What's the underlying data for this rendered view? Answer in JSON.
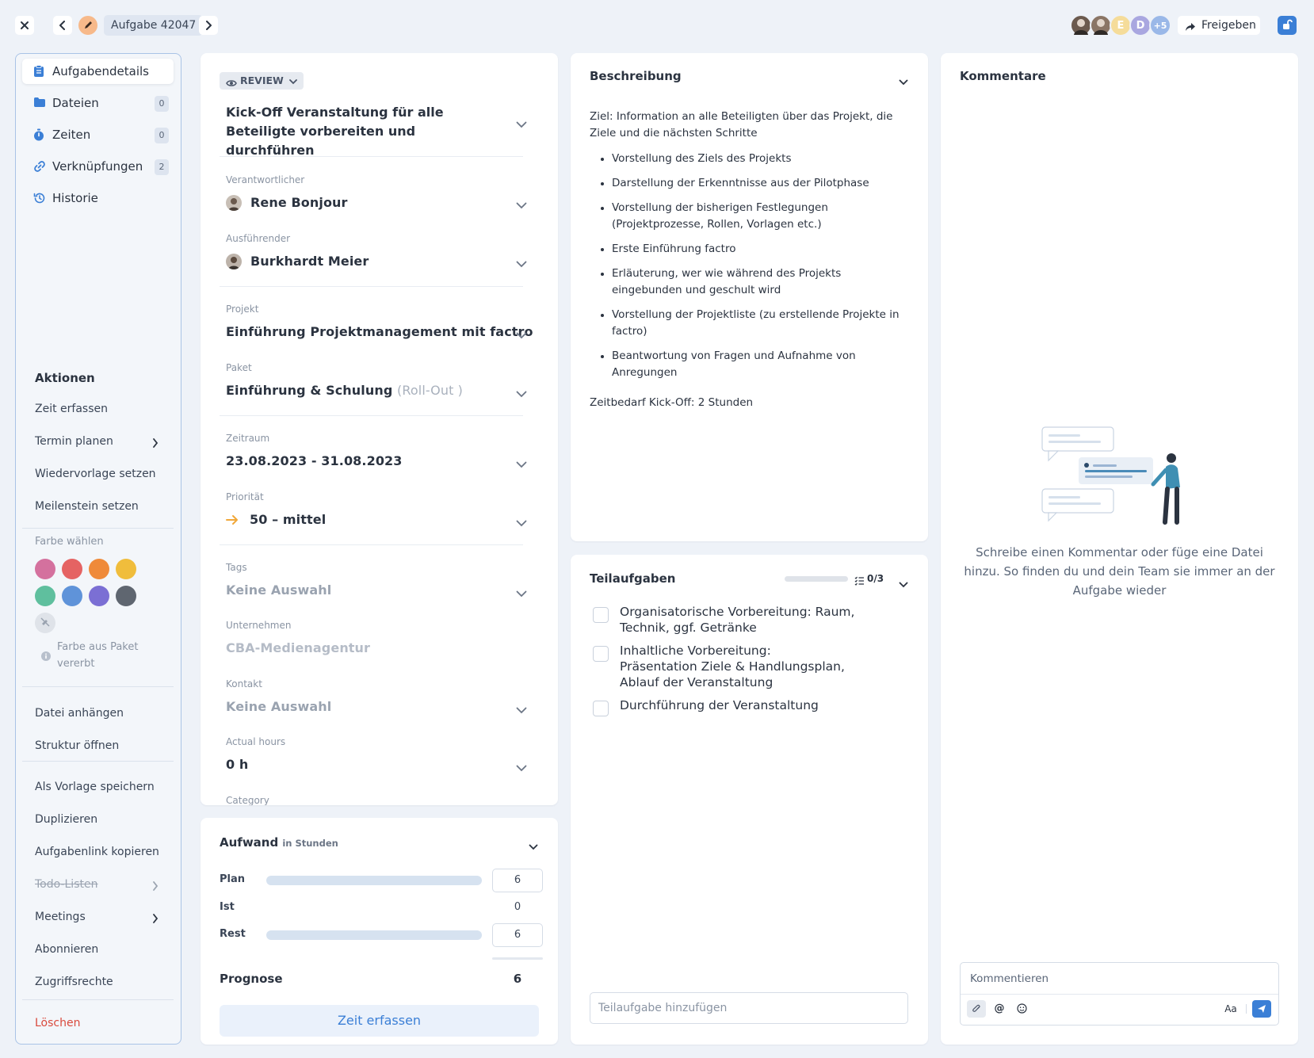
{
  "header": {
    "task_label": "Aufgabe 42047",
    "share_label": "Freigeben",
    "avatars": [
      {
        "type": "photo",
        "color": "#6b5a4e"
      },
      {
        "type": "photo",
        "color": "#8a7565"
      },
      {
        "type": "letter",
        "letter": "E",
        "color": "#f5dc9a"
      },
      {
        "type": "letter",
        "letter": "D",
        "color": "#a9a7e0"
      },
      {
        "type": "more",
        "letter": "+5",
        "color": "#9ab8e8"
      }
    ],
    "accent": "#3b7fd6"
  },
  "sidebar": {
    "nav": [
      {
        "label": "Aufgabendetails",
        "icon": "clipboard-icon",
        "active": true,
        "count": ""
      },
      {
        "label": "Dateien",
        "icon": "folder-icon",
        "active": false,
        "count": "0"
      },
      {
        "label": "Zeiten",
        "icon": "stopwatch-icon",
        "active": false,
        "count": "0"
      },
      {
        "label": "Verknüpfungen",
        "icon": "link-icon",
        "active": false,
        "count": "2"
      },
      {
        "label": "Historie",
        "icon": "history-icon",
        "active": false,
        "count": ""
      }
    ],
    "actions_title": "Aktionen",
    "actions_group1": [
      "Zeit erfassen",
      "Termin planen",
      "Wiedervorlage setzen",
      "Meilenstein setzen"
    ],
    "color_title": "Farbe wählen",
    "colors": [
      "#d4719e",
      "#e56363",
      "#ef8a3a",
      "#f0bd3c",
      "#5fbf9e",
      "#5f93d9",
      "#7b6fd4",
      "#5f6670"
    ],
    "color_inherit_note": "Farbe aus Paket vererbt",
    "actions_group2": [
      "Datei anhängen",
      "Struktur öffnen"
    ],
    "actions_group3": [
      "Als Vorlage speichern",
      "Duplizieren",
      "Aufgabenlink kopieren",
      "Todo-Listen",
      "Meetings",
      "Abonnieren",
      "Zugriffsrechte"
    ],
    "delete_label": "Löschen"
  },
  "task": {
    "status": "REVIEW",
    "title": "Kick-Off Veranstaltung für alle Beteiligte vorbereiten und durchführen",
    "fields": {
      "responsible_label": "Verantwortlicher",
      "responsible_value": "Rene Bonjour",
      "executor_label": "Ausführender",
      "executor_value": "Burkhardt Meier",
      "project_label": "Projekt",
      "project_value": "Einführung Projektmanagement mit factro",
      "package_label": "Paket",
      "package_value": "Einführung & Schulung",
      "package_suffix": "(Roll-Out )",
      "period_label": "Zeitraum",
      "period_value": "23.08.2023 - 31.08.2023",
      "priority_label": "Priorität",
      "priority_value": "50 – mittel",
      "tags_label": "Tags",
      "tags_value": "Keine Auswahl",
      "company_label": "Unternehmen",
      "company_value": "CBA-Medienagentur",
      "contact_label": "Kontakt",
      "contact_value": "Keine Auswahl",
      "hours_label": "Actual hours",
      "hours_value": "0 h",
      "category_label": "Category"
    }
  },
  "effort": {
    "title": "Aufwand",
    "unit": "in Stunden",
    "plan_label": "Plan",
    "plan_value": "6",
    "ist_label": "Ist",
    "ist_value": "0",
    "rest_label": "Rest",
    "rest_value": "6",
    "forecast_label": "Prognose",
    "forecast_value": "6",
    "button_label": "Zeit erfassen"
  },
  "description": {
    "title": "Beschreibung",
    "intro": "Ziel: Information an alle Beteiligten über das Projekt, die Ziele und die nächsten Schritte",
    "bullets": [
      "Vorstellung des Ziels des Projekts",
      "Darstellung der Erkenntnisse aus der Pilotphase",
      "Vorstellung der bisherigen Festlegungen (Projektprozesse, Rollen, Vorlagen etc.)",
      "Erste Einführung factro",
      "Erläuterung, wer wie während des Projekts eingebunden und geschult wird",
      "Vorstellung der Projektliste (zu erstellende Projekte in factro)",
      "Beantwortung von Fragen und Aufnahme von Anregungen"
    ],
    "footer": "Zeitbedarf Kick-Off: 2 Stunden"
  },
  "subtasks": {
    "title": "Teilaufgaben",
    "progress_text": "0/3",
    "progress_fraction": 0,
    "items": [
      "Organisatorische Vorbereitung: Raum, Technik, ggf. Getränke",
      "Inhaltliche Vorbereitung: Präsentation Ziele & Handlungsplan, Ablauf der Veranstaltung",
      "Durchführung der Veranstaltung"
    ],
    "add_placeholder": "Teilaufgabe hinzufügen"
  },
  "comments": {
    "title": "Kommentare",
    "empty_text": "Schreibe einen Kommentar oder füge eine Datei hinzu. So finden du und dein Team sie immer an der Aufgabe wieder",
    "input_placeholder": "Kommentieren",
    "format_label": "Aa"
  }
}
